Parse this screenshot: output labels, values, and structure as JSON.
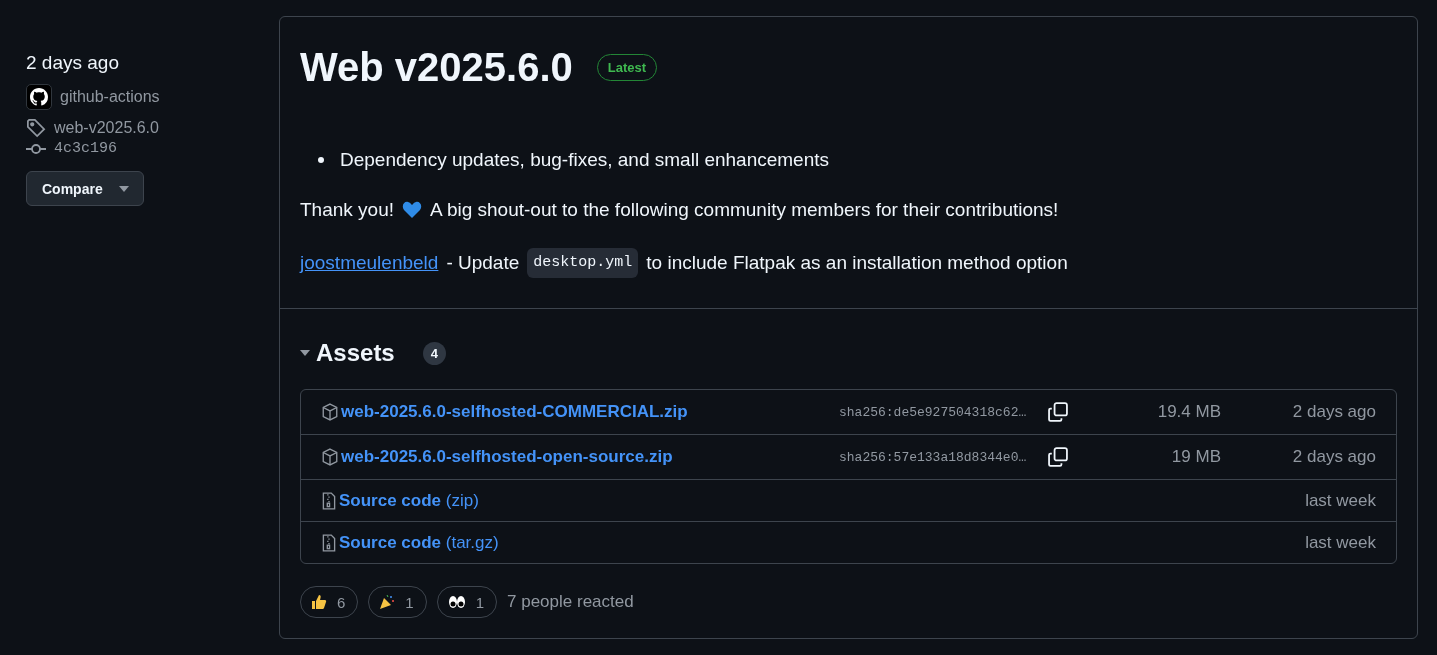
{
  "sidebar": {
    "time": "2 days ago",
    "author": "github-actions",
    "tag": "web-v2025.6.0",
    "commit": "4c3c196",
    "compare_button": "Compare"
  },
  "release": {
    "title": "Web v2025.6.0",
    "badge": "Latest",
    "bullets": [
      "Dependency updates, bug-fixes, and small enhancements"
    ],
    "thanks": "Thank you!",
    "thanks_rest": "A big shout-out to the following community members for their contributions!",
    "contribution": {
      "user": "joostmeulenbeld",
      "before": "- Update",
      "code": "desktop.yml",
      "after": "to include Flatpak as an installation method option"
    }
  },
  "assets": {
    "title": "Assets",
    "count": "4",
    "expanded": true,
    "items": [
      {
        "kind": "package",
        "name": "web-2025.6.0-selfhosted-COMMERCIAL.zip",
        "sha": "sha256:de5e927504318c62…",
        "size": "19.4 MB",
        "date": "2 days ago"
      },
      {
        "kind": "package",
        "name": "web-2025.6.0-selfhosted-open-source.zip",
        "sha": "sha256:57e133a18d8344e0…",
        "size": "19 MB",
        "date": "2 days ago"
      },
      {
        "kind": "source",
        "name": "Source code",
        "suffix": "(zip)",
        "date": "last week"
      },
      {
        "kind": "source",
        "name": "Source code",
        "suffix": "(tar.gz)",
        "date": "last week"
      }
    ]
  },
  "reactions": {
    "items": [
      {
        "kind": "thumbs-up",
        "count": "6"
      },
      {
        "kind": "party",
        "count": "1"
      },
      {
        "kind": "eyes",
        "count": "1"
      }
    ],
    "summary": "7 people reacted"
  }
}
